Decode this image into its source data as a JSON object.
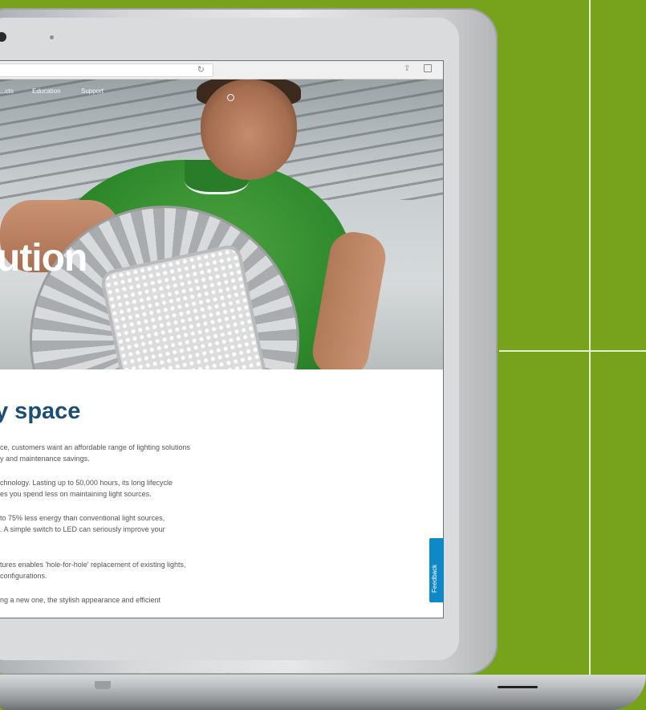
{
  "browser": {
    "reload_icon": "reload-icon",
    "share_icon": "share-icon",
    "tabs_icon": "tabs-icon"
  },
  "nav": {
    "items": [
      {
        "label": "...cts"
      },
      {
        "label": "Education"
      },
      {
        "label": "Support"
      }
    ],
    "search_icon": "search-icon"
  },
  "hero": {
    "title": "ution"
  },
  "article": {
    "title": "y space",
    "paragraphs": [
      [
        "ce, customers want an affordable range of lighting solutions",
        "y and maintenance savings."
      ],
      [
        "chnology. Lasting up to 50,000 hours, its long lifecycle",
        "es you spend less on maintaining light sources."
      ],
      [
        "to 75% less energy than conventional light sources,",
        ". A simple switch to LED can seriously improve your"
      ],
      [
        "tures enables 'hole-for-hole' replacement of existing lights,",
        "configurations."
      ],
      [
        "ng a new one, the stylish appearance and efficient"
      ]
    ]
  },
  "feedback": {
    "label": "Feedback",
    "color": "#0e89c8"
  },
  "colors": {
    "background": "#77a31c",
    "heading": "#1e4e73"
  }
}
